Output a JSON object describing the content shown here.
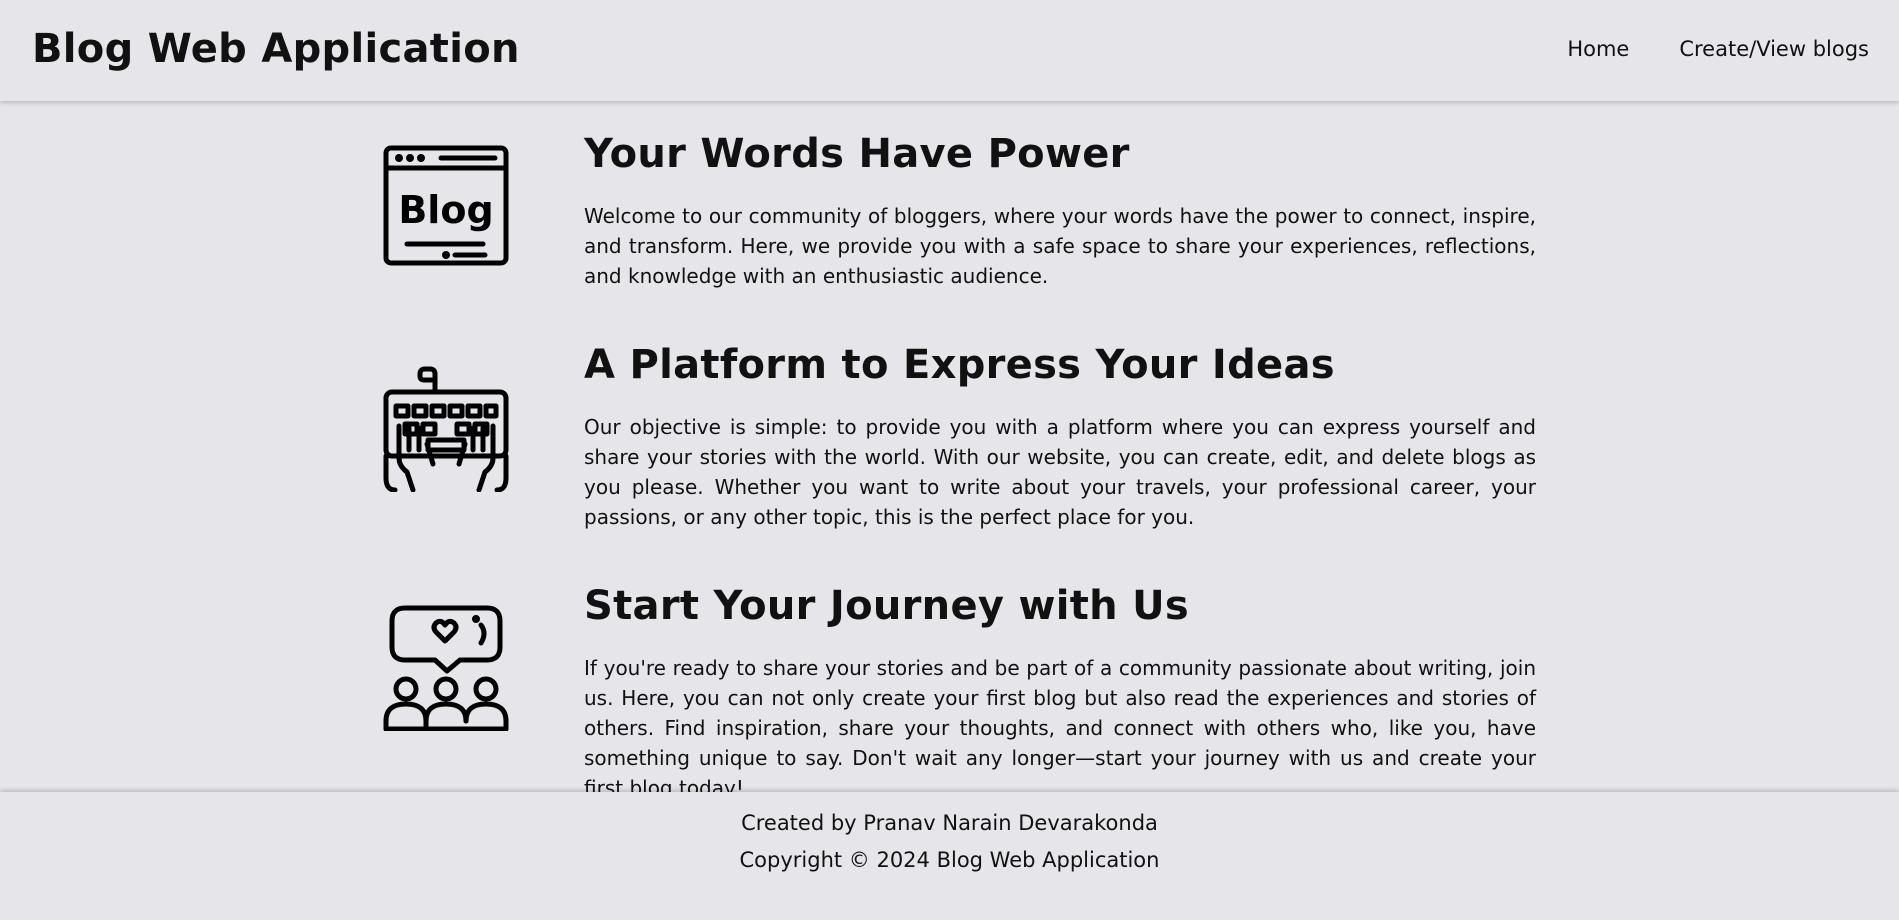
{
  "navbar": {
    "brand": "Blog Web Application",
    "links": [
      {
        "label": "Home"
      },
      {
        "label": "Create/View blogs"
      }
    ]
  },
  "sections": [
    {
      "icon": "blog-browser-icon",
      "icon_text": "Blog",
      "title": "Your Words Have Power",
      "text": "Welcome to our community of bloggers, where your words have the power to connect, inspire, and transform. Here, we provide you with a safe space to share your experiences, reflections, and knowledge with an enthusiastic audience."
    },
    {
      "icon": "keyboard-typing-icon",
      "title": "A Platform to Express Your Ideas",
      "text": "Our objective is simple: to provide you with a platform where you can express yourself and share your stories with the world. With our website, you can create, edit, and delete blogs as you please. Whether you want to write about your travels, your professional career, your passions, or any other topic, this is the perfect place for you."
    },
    {
      "icon": "community-chat-icon",
      "title": "Start Your Journey with Us",
      "text": "If you're ready to share your stories and be part of a community passionate about writing, join us. Here, you can not only create your first blog but also read the experiences and stories of others. Find inspiration, share your thoughts, and connect with others who, like you, have something unique to say. Don't wait any longer—start your journey with us and create your first blog today!"
    }
  ],
  "footer": {
    "credit": "Created by Pranav Narain Devarakonda",
    "copyright": "Copyright © 2024 Blog Web Application"
  },
  "colors": {
    "background": "#e6e6ea",
    "text": "#111111"
  }
}
